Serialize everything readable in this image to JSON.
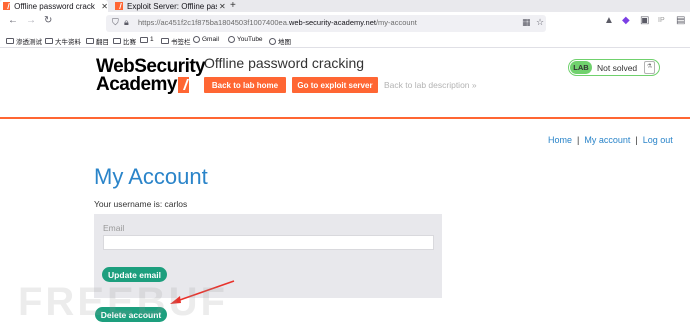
{
  "browser": {
    "tabs": [
      {
        "label": "Offline password cracking",
        "active": true
      },
      {
        "label": "Exploit Server: Offline passw",
        "active": false
      }
    ],
    "new_tab": "+",
    "url_prefix": "https://ac451f2c1f875ba1804503f1007400ea.",
    "url_domain": "web-security-academy.net",
    "url_path": "/my-account",
    "bookmarks": [
      "渗透测试",
      "大牛资料",
      "翻目",
      "比赛",
      "1",
      "书签栏",
      "Gmail",
      "YouTube",
      "地图"
    ]
  },
  "header": {
    "logo_line1": "WebSecurity",
    "logo_line2": "Academy",
    "lab_title": "Offline password cracking",
    "back_home": "Back to lab home",
    "exploit_server": "Go to exploit server",
    "back_description": "Back to lab description »",
    "status_badge": "LAB",
    "status_text": "Not solved"
  },
  "top_links": {
    "home": "Home",
    "sep": "|",
    "my_account": "My account",
    "logout": "Log out"
  },
  "main": {
    "heading": "My Account",
    "username_text": "Your username is: carlos",
    "email_label": "Email",
    "email_value": "",
    "update_button": "Update email",
    "delete_button": "Delete account"
  },
  "colors": {
    "accent_orange": "#ff6633",
    "link_blue": "#2a84c9",
    "button_green": "#1d9f7e",
    "status_green": "#70d16d",
    "annotation_red": "#e8322b"
  },
  "watermark": "FREEBUF"
}
